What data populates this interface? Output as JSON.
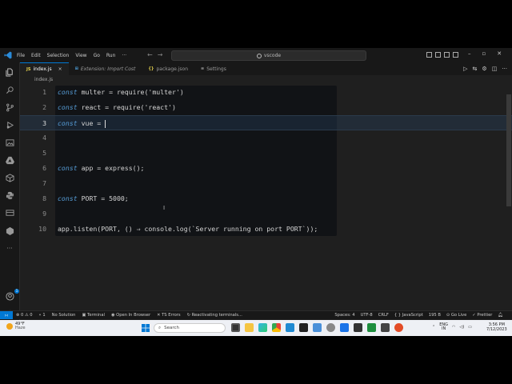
{
  "titlebar": {
    "menu": [
      "File",
      "Edit",
      "Selection",
      "View",
      "Go",
      "Run",
      "···"
    ],
    "search_text": "vscode"
  },
  "tabs": [
    {
      "icon": "JS",
      "label": "index.js",
      "active": true
    },
    {
      "icon": "",
      "label": "Extension: Import Cost",
      "active": false
    },
    {
      "icon": "{}",
      "label": "package.json",
      "active": false
    },
    {
      "icon": "",
      "label": "Settings",
      "active": false
    }
  ],
  "breadcrumb": "index.js",
  "editor": {
    "lines": [
      {
        "n": "1",
        "kw": "const",
        "rest": " multer = require('multer')"
      },
      {
        "n": "2",
        "kw": "const",
        "rest": " react = require('react')"
      },
      {
        "n": "3",
        "kw": "const",
        "rest": " vue = "
      },
      {
        "n": "4",
        "kw": "",
        "rest": ""
      },
      {
        "n": "5",
        "kw": "",
        "rest": ""
      },
      {
        "n": "6",
        "kw": "const",
        "rest": " app = express();"
      },
      {
        "n": "7",
        "kw": "",
        "rest": ""
      },
      {
        "n": "8",
        "kw": "const",
        "rest": " PORT = 5000;"
      },
      {
        "n": "9",
        "kw": "",
        "rest": ""
      },
      {
        "n": "10",
        "kw": "",
        "rest": "app.listen(PORT, () ⇒ console.log(`Server running on port PORT`));"
      }
    ],
    "current_line": "3"
  },
  "statusbar": {
    "errors": "⊗ 0 ⚠ 0",
    "ports": "1",
    "solution": "No Solution",
    "terminal": "Terminal",
    "browser": "Open In Browser",
    "ts_errors": "TS Errors",
    "reactivating": "Reactivating terminals...",
    "spaces": "Spaces: 4",
    "encoding": "UTF-8",
    "eol": "CRLF",
    "language": "JavaScript",
    "size": "195 B",
    "golive": "Go Live",
    "prettier": "Prettier"
  },
  "taskbar": {
    "weather_temp": "49°F",
    "weather_desc": "Haze",
    "search_placeholder": "Search",
    "lang": "ENG",
    "lang_sub": "IN",
    "time": "3:56 PM",
    "date": "7/12/2023"
  },
  "colors": {
    "accent": "#0078d4",
    "keyword": "#569cd6",
    "editor_bg": "#1f1f1f",
    "code_panel_bg": "#111316"
  }
}
